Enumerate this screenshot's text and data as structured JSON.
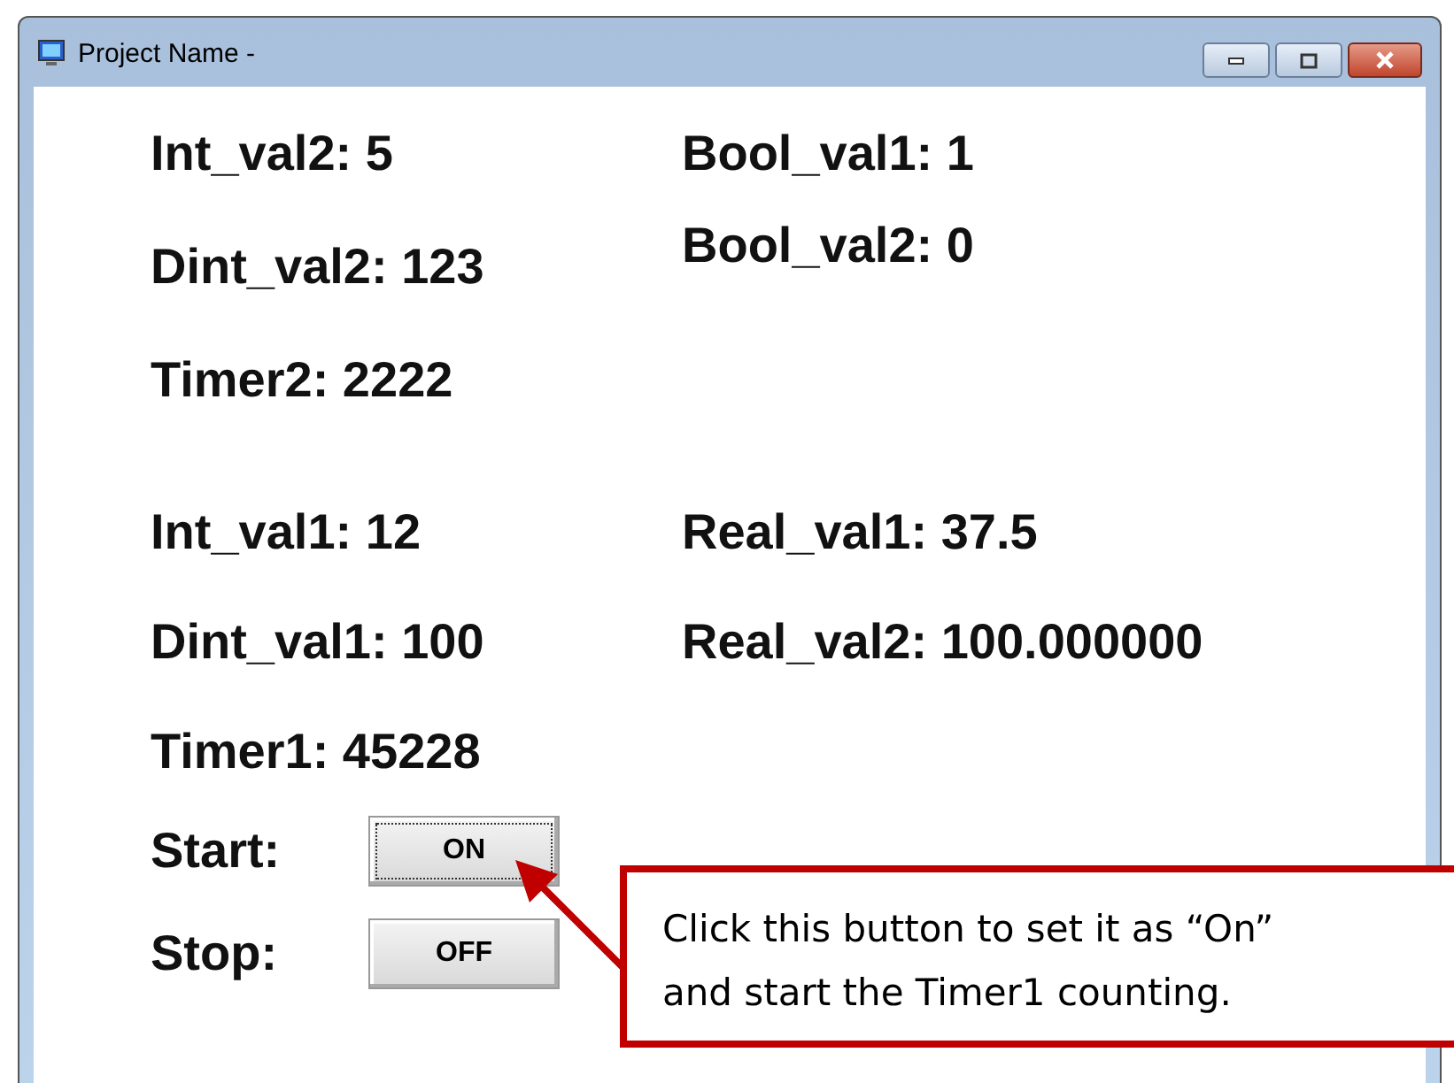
{
  "window": {
    "title": "Project Name -"
  },
  "group_1": {
    "left": [
      "Int_val2: 5",
      "Dint_val2: 123",
      "Timer2: 2222"
    ],
    "right": [
      "Bool_val1: 1",
      "Bool_val2: 0"
    ]
  },
  "group_2": {
    "left": [
      "Int_val1: 12",
      "Dint_val1: 100",
      "Timer1: 45228"
    ],
    "right": [
      "Real_val1: 37.5",
      "Real_val2: 100.000000"
    ]
  },
  "controls": [
    {
      "label": "Start:",
      "button": "ON",
      "focused": true
    },
    {
      "label": "Stop:",
      "button": "OFF",
      "focused": false
    }
  ],
  "callout": {
    "text": "Click this button to set it as “On” and start the Timer1 counting."
  }
}
